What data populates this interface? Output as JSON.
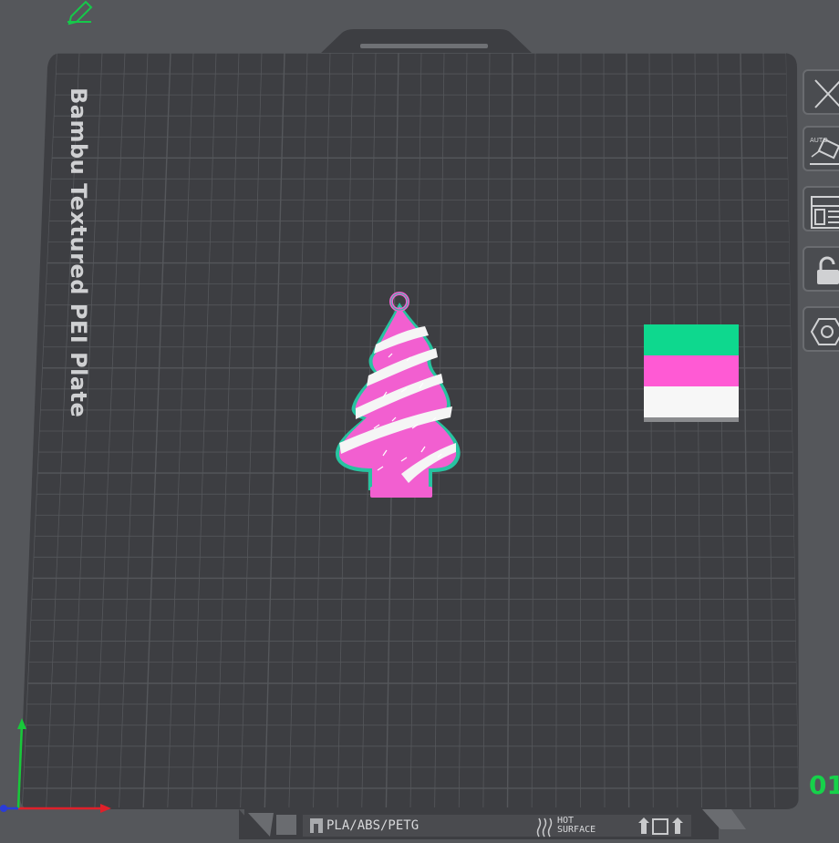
{
  "plate": {
    "name": "Bambu Textured PEI Plate",
    "number": "01",
    "filament_label": "PLA/ABS/PETG",
    "hot_label_line1": "HOT",
    "hot_label_line2": "SURFACE"
  },
  "toolbar": {
    "auto_label": "AUTO"
  },
  "colors": {
    "background": "#55575b",
    "plate": "#3d3e42",
    "grid": "#55575b",
    "model_pink": "#f25fd0",
    "model_white": "#f5f5f5",
    "model_teal": "#27c3a0",
    "wipe_green": "#0ed88e",
    "wipe_pink": "#ff5ad4",
    "wipe_white": "#f7f7f7",
    "plate_number": "#16d24a",
    "axis_x": "#e0202a",
    "axis_y": "#18c83a",
    "axis_z": "#2a3cd8"
  },
  "objects": [
    {
      "name": "Christmas tree ornament"
    },
    {
      "name": "Prime tower"
    }
  ],
  "icons": [
    "edit-pencil-icon",
    "close-icon",
    "auto-orient-icon",
    "arrange-icon",
    "lock-icon",
    "plate-settings-icon",
    "heat-warning-icon",
    "plate-lift-icon"
  ]
}
